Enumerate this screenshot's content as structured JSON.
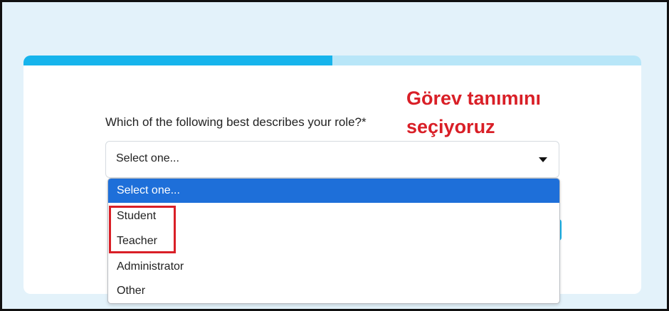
{
  "progress": {
    "fraction": 0.5,
    "fill_color": "#16b4ec",
    "track_color": "#b8e6f8"
  },
  "form": {
    "question": "Which of the following best describes your role?*",
    "select": {
      "value": "Select one...",
      "caret_icon": "caret-down-icon"
    }
  },
  "dropdown": {
    "options": [
      "Select one...",
      "Student",
      "Teacher",
      "Administrator",
      "Other"
    ],
    "selected_index": 0,
    "highlight_color": "#1e6fd9"
  },
  "annotation": {
    "line1": "Görev tanımını",
    "line2": "seçiyoruz",
    "color": "#d91f27"
  }
}
